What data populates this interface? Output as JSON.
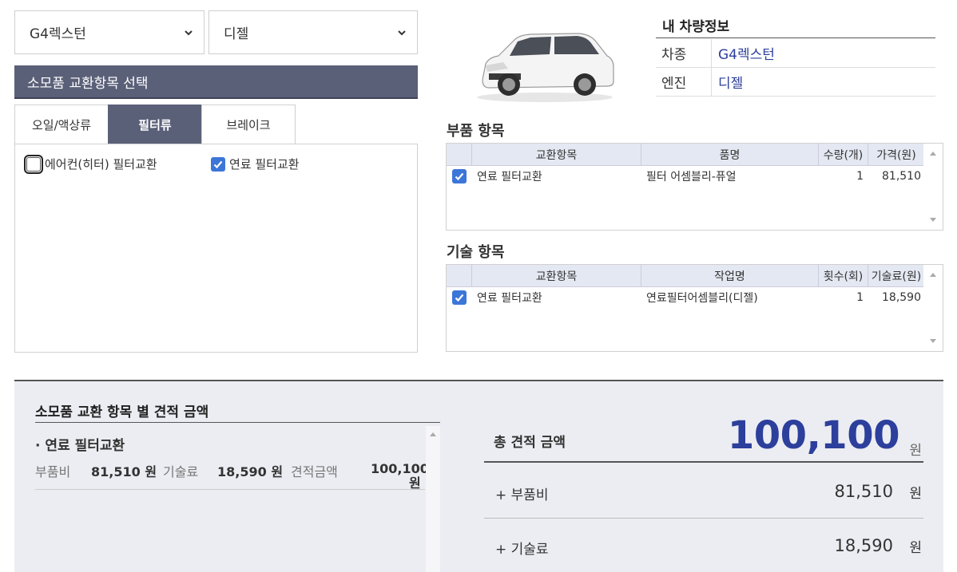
{
  "selects": {
    "model": "G4렉스턴",
    "engine": "디젤"
  },
  "section_title": "소모품 교환항목 선택",
  "tabs": [
    {
      "label": "오일/액상류"
    },
    {
      "label": "필터류"
    },
    {
      "label": "브레이크"
    }
  ],
  "active_tab": "필터류",
  "filter_items": [
    {
      "label": "에어컨(히터) 필터교환",
      "checked": false
    },
    {
      "label": "연료 필터교환",
      "checked": true
    }
  ],
  "vehicle_info": {
    "title": "내 차량정보",
    "rows": [
      {
        "key": "차종",
        "value": "G4렉스턴"
      },
      {
        "key": "엔진",
        "value": "디젤"
      }
    ]
  },
  "parts": {
    "title": "부품 항목",
    "headers": [
      "교환항목",
      "품명",
      "수량(개)",
      "가격(원)"
    ],
    "rows": [
      {
        "checked": true,
        "item": "연료 필터교환",
        "name": "필터 어셈블리-퓨얼",
        "qty": "1",
        "price": "81,510"
      }
    ]
  },
  "labor": {
    "title": "기술 항목",
    "headers": [
      "교환항목",
      "작업명",
      "횟수(회)",
      "기술료(원)"
    ],
    "rows": [
      {
        "checked": true,
        "item": "연료 필터교환",
        "name": "연료필터어셈블리(디젤)",
        "qty": "1",
        "price": "18,590"
      }
    ]
  },
  "estimate": {
    "title": "소모품 교환 항목 별 견적 금액",
    "item_name": "· 연료 필터교환",
    "parts_label": "부품비",
    "parts_value": "81,510 원",
    "labor_label": "기술료",
    "labor_value": "18,590 원",
    "est_label": "견적금액",
    "est_value_num": "100,100",
    "est_value_unit": "원"
  },
  "total": {
    "label": "총 견적 금액",
    "amount": "100,100",
    "unit": "원",
    "rows": [
      {
        "label": "+ 부품비",
        "value": "81,510",
        "unit": "원"
      },
      {
        "label": "+ 기술료",
        "value": "18,590",
        "unit": "원"
      }
    ]
  },
  "colors": {
    "accent": "#5b6079",
    "amount_blue": "#2c3f9c",
    "checkbox": "#3b76d8"
  }
}
